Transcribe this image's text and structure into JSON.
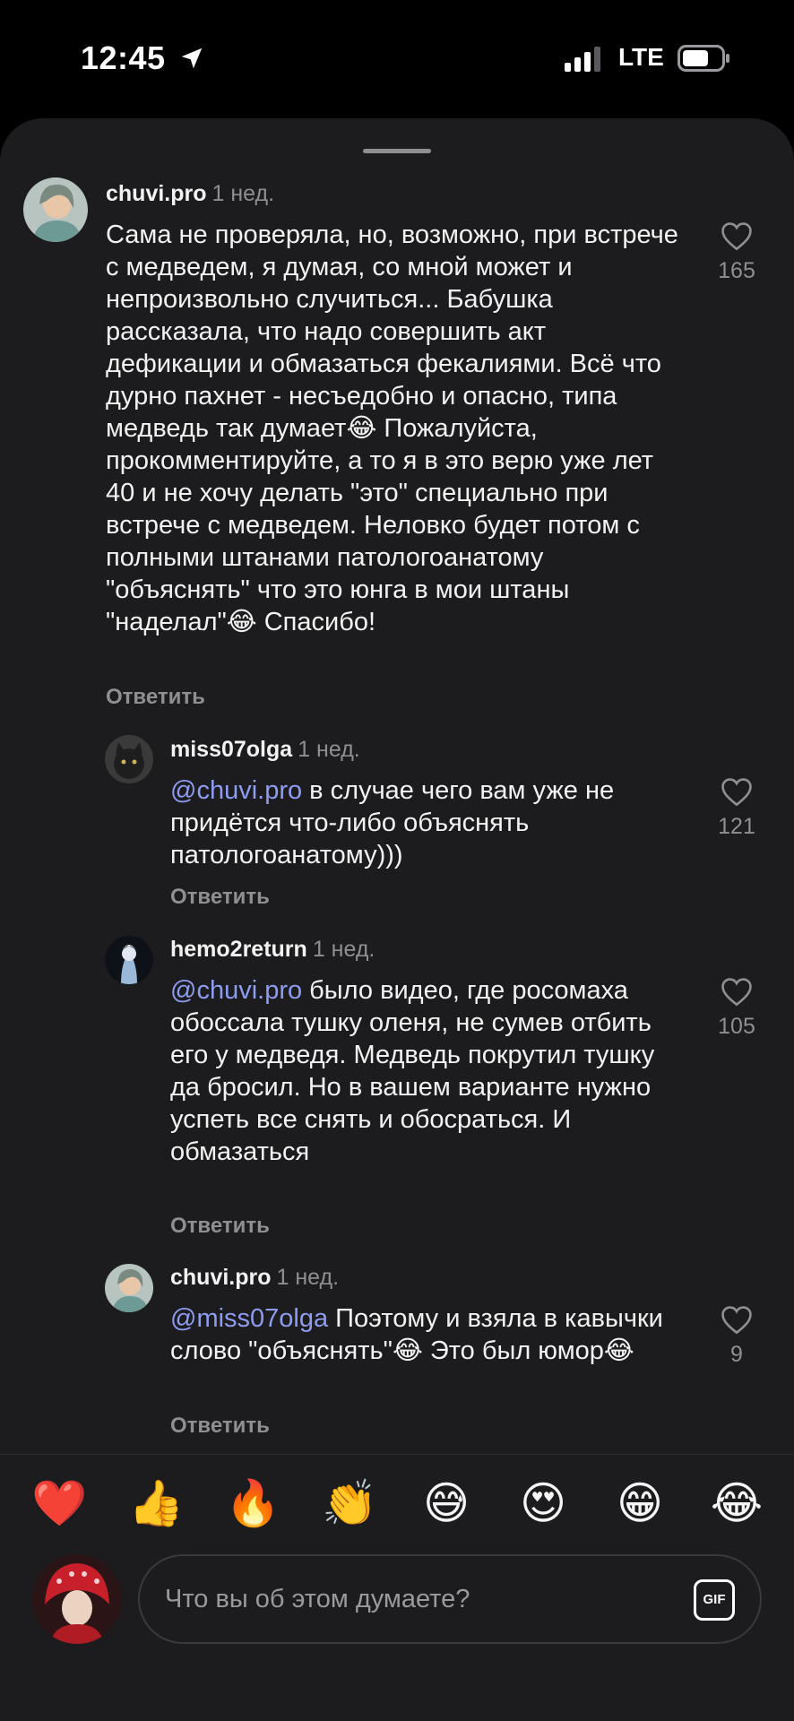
{
  "status_bar": {
    "time": "12:45",
    "network": "LTE",
    "icons": [
      "location-arrow-icon",
      "signal-bars-icon",
      "battery-icon"
    ]
  },
  "comments": [
    {
      "username": "chuvi.pro",
      "time": "1 нед.",
      "mention": "",
      "text": "Сама не проверяла, но, возможно, при встрече с медведем, я думая, со мной может и непроизвольно случиться... Бабушка рассказала, что надо совершить акт дефикации и обмазаться фекалиями. Всё что дурно пахнет - несъедобно и опасно, типа медведь так думает😂 Пожалуйста, прокомментируйте, а то я в это верю уже лет 40 и не хочу делать \"это\" специально при встрече с медведем. Неловко будет потом с полными штанами патологоанатому \"объяснять\" что это юнга в мои штаны \"наделал\"😂 Спасибо!",
      "reply_label": "Ответить",
      "likes": "165"
    },
    {
      "username": "miss07olga",
      "time": "1 нед.",
      "mention": "@chuvi.pro",
      "text": " в случае чего вам уже не придётся что-либо объяснять патологоанатому)))",
      "reply_label": "Ответить",
      "likes": "121"
    },
    {
      "username": "hemo2return",
      "time": "1 нед.",
      "mention": "@chuvi.pro",
      "text": " было видео, где росомаха обоссала тушку оленя, не сумев отбить его у медведя. Медведь покрутил тушку да бросил. Но в вашем варианте нужно успеть все снять и обосраться. И обмазаться",
      "reply_label": "Ответить",
      "likes": "105"
    },
    {
      "username": "chuvi.pro",
      "time": "1 нед.",
      "mention": "@miss07olga",
      "text": " Поэтому и взяла в кавычки слово \"объяснять\"😂 Это был юмор😂",
      "reply_label": "Ответить",
      "likes": "9"
    }
  ],
  "reactions": [
    "❤️",
    "👍",
    "🔥",
    "👏",
    "😅",
    "😍",
    "😁",
    "😂"
  ],
  "composer": {
    "placeholder": "Что вы об этом думаете?",
    "gif_label": "GIF"
  },
  "colors": {
    "sheet_bg": "#1c1c1e",
    "mention": "#8d9cf0",
    "muted": "#8e8e93"
  }
}
